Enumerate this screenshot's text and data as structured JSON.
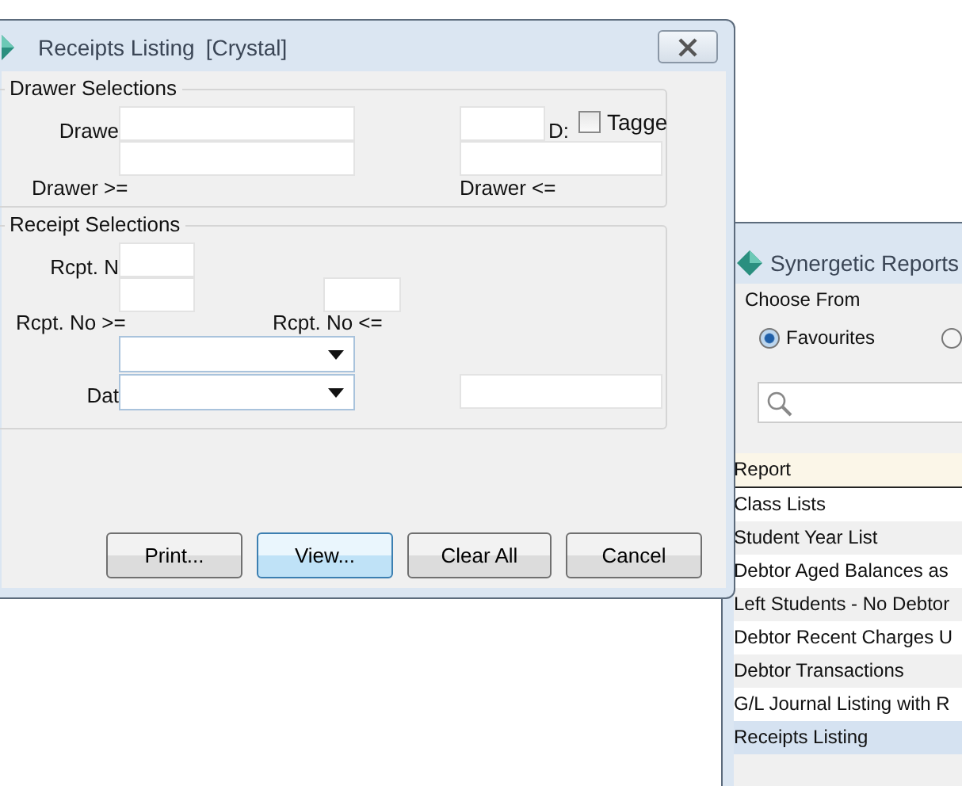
{
  "dialog": {
    "title": "Receipts Listing",
    "subtitle": "[Crystal]",
    "drawer_group": {
      "legend": "Drawer Selections",
      "label_1": "Drawe",
      "label_2": "Drawer >=",
      "label_3": "D:",
      "label_4": "Drawer <=",
      "tagged": {
        "label": "Tagge",
        "checked": false
      }
    },
    "receipt_group": {
      "legend": "Receipt Selections",
      "label_1": "Rcpt. N",
      "label_2": "Rcpt. No >=",
      "label_3": "Rcpt. No <=",
      "label_4": "Dat"
    },
    "buttons": [
      {
        "label": "Print...",
        "default": false
      },
      {
        "label": "View...",
        "default": true
      },
      {
        "label": "Clear All",
        "default": false
      },
      {
        "label": "Cancel",
        "default": false
      }
    ]
  },
  "reports_window": {
    "title": "Synergetic Reports",
    "group": "Choose From",
    "radios": [
      {
        "label": "Favourites",
        "selected": true
      },
      {
        "selected": false
      }
    ],
    "table": {
      "columns": [
        "Report"
      ],
      "rows": [
        {
          "name": "Class Lists",
          "selected": false
        },
        {
          "name": "Student Year List",
          "selected": false
        },
        {
          "name": "Debtor Aged Balances as",
          "selected": false
        },
        {
          "name": "Left Students - No Debtor",
          "selected": false
        },
        {
          "name": "Debtor Recent Charges U",
          "selected": false
        },
        {
          "name": "Debtor Transactions",
          "selected": false
        },
        {
          "name": "G/L Journal Listing with R",
          "selected": false
        },
        {
          "name": "Receipts Listing",
          "selected": true
        }
      ]
    }
  }
}
